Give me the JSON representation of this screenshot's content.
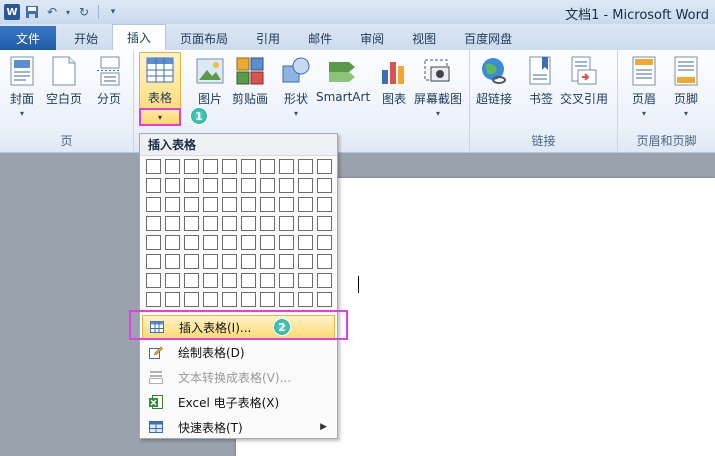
{
  "app": {
    "logo": "W",
    "window_title": "文档1 - Microsoft Word"
  },
  "tabs": [
    {
      "label": "文件"
    },
    {
      "label": "开始"
    },
    {
      "label": "插入"
    },
    {
      "label": "页面布局"
    },
    {
      "label": "引用"
    },
    {
      "label": "邮件"
    },
    {
      "label": "审阅"
    },
    {
      "label": "视图"
    },
    {
      "label": "百度网盘"
    }
  ],
  "ribbon": {
    "groups": {
      "pages": {
        "label": "页"
      },
      "links": {
        "label": "链接"
      },
      "header_footer": {
        "label": "页眉和页脚"
      }
    },
    "buttons": {
      "cover": "封面",
      "blank_page": "空白页",
      "page_break": "分页",
      "table": "表格",
      "picture": "图片",
      "clip_art": "剪贴画",
      "shapes": "形状",
      "smartart": "SmartArt",
      "chart": "图表",
      "screenshot": "屏幕截图",
      "hyperlink": "超链接",
      "bookmark": "书签",
      "cross_ref": "交叉引用",
      "header": "页眉",
      "footer": "页脚"
    }
  },
  "badges": {
    "step1": "1",
    "step2": "2"
  },
  "dropdown": {
    "header": "插入表格",
    "items": [
      {
        "label": "插入表格(I)...",
        "highlighted": true
      },
      {
        "label": "绘制表格(D)"
      },
      {
        "label": "文本转换成表格(V)...",
        "disabled": true
      },
      {
        "label": "Excel 电子表格(X)"
      },
      {
        "label": "快速表格(T)",
        "submenu": true
      }
    ]
  },
  "colors": {
    "file_tab": "#2b6cc2",
    "highlight": "#fdda77",
    "annotation_frame": "#e040e0",
    "badge": "#1fa89b"
  }
}
